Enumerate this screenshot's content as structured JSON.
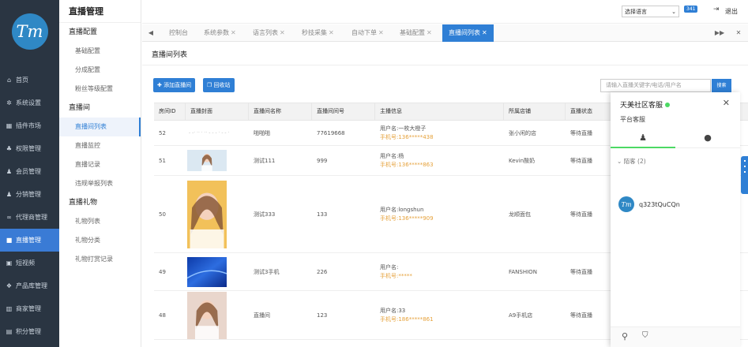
{
  "logo": {
    "text": "Tm"
  },
  "nav": [
    {
      "icon": "home-icon",
      "glyph": "⌂",
      "label": "首页"
    },
    {
      "icon": "gear-icon",
      "glyph": "✲",
      "label": "系统设置"
    },
    {
      "icon": "plugin-icon",
      "glyph": "▦",
      "label": "插件市场"
    },
    {
      "icon": "sitemap-icon",
      "glyph": "♣",
      "label": "权限管理"
    },
    {
      "icon": "users-icon",
      "glyph": "♟",
      "label": "会员管理"
    },
    {
      "icon": "users-icon",
      "glyph": "♟",
      "label": "分销管理"
    },
    {
      "icon": "handshake-icon",
      "glyph": "∞",
      "label": "代理商管理"
    },
    {
      "icon": "video-icon",
      "glyph": "■",
      "label": "直播管理"
    },
    {
      "icon": "film-icon",
      "glyph": "▣",
      "label": "短视频"
    },
    {
      "icon": "cube-icon",
      "glyph": "❖",
      "label": "产品库管理"
    },
    {
      "icon": "bank-icon",
      "glyph": "▥",
      "label": "商家管理"
    },
    {
      "icon": "coin-icon",
      "glyph": "▤",
      "label": "积分管理"
    }
  ],
  "submenu": {
    "title": "直播管理",
    "groups": [
      {
        "label": "直播配置",
        "items": [
          "基础配置",
          "分成配置",
          "粉丝等级配置"
        ]
      },
      {
        "label": "直播间",
        "items": [
          "直播间列表",
          "直播监控",
          "直播记录",
          "违规举报列表"
        ]
      },
      {
        "label": "直播礼物",
        "items": [
          "礼物列表",
          "礼物分类",
          "礼物打赏记录"
        ]
      }
    ]
  },
  "topbar": {
    "lang_select": "选择语言",
    "badge": "341",
    "logout": "退出"
  },
  "tabs": [
    {
      "label": "控制台",
      "closable": false
    },
    {
      "label": "系统参数",
      "closable": true
    },
    {
      "label": "语言列表",
      "closable": true
    },
    {
      "label": "秒技采集",
      "closable": true
    },
    {
      "label": "自动下单",
      "closable": true
    },
    {
      "label": "基础配置",
      "closable": true
    },
    {
      "label": "直播间列表",
      "closable": true
    }
  ],
  "page": {
    "title": "直播间列表",
    "add_button": "添加直播间",
    "recycle_button": "回收站",
    "search_placeholder": "请输入直播关键字/电话/用户名",
    "search_button": "搜索"
  },
  "table": {
    "columns": [
      "房间ID",
      "直播封面",
      "直播间名称",
      "直播间间号",
      "主播信息",
      "所属店铺",
      "直播状态"
    ],
    "rows": [
      {
        "id": "52",
        "cover": "text",
        "cover_text": "- -· ·· · ·· - - - · - - ·",
        "name": "啪啪啪",
        "number": "77619668",
        "host_user": "用户名:一枚大橙子",
        "host_phone": "手机号:136*****438",
        "shop": "张小闲的店",
        "status": "等待直播"
      },
      {
        "id": "51",
        "cover": "girl1",
        "name": "测试111",
        "number": "999",
        "host_user": "用户名:杨",
        "host_phone": "手机号:136*****863",
        "shop": "Kevin酸奶",
        "status": "等待直播"
      },
      {
        "id": "50",
        "cover": "girl2",
        "name": "测试333",
        "number": "133",
        "host_user": "用户名:longshun",
        "host_phone": "手机号:136*****909",
        "shop": "龙顺面包",
        "status": "等待直播"
      },
      {
        "id": "49",
        "cover": "blue",
        "name": "测试3手机",
        "number": "226",
        "host_user": "用户名:",
        "host_phone": "手机号:*****",
        "shop": "FANSHION",
        "status": "等待直播"
      },
      {
        "id": "48",
        "cover": "girl3",
        "name": "直播间",
        "number": "123",
        "host_user": "用户名:33",
        "host_phone": "手机号:186*****861",
        "shop": "A9手机店",
        "status": "等待直播"
      }
    ]
  },
  "chat": {
    "title": "天美社区客服",
    "subtitle": "平台客服",
    "group": "陌客 (2)",
    "contact_name": "q323tQuCQn",
    "avatar_text": "Tm"
  },
  "colors": {
    "primary": "#2f7fd5",
    "sidebar": "#2a3542",
    "online": "#4cd964",
    "phone": "#e6a23c"
  }
}
